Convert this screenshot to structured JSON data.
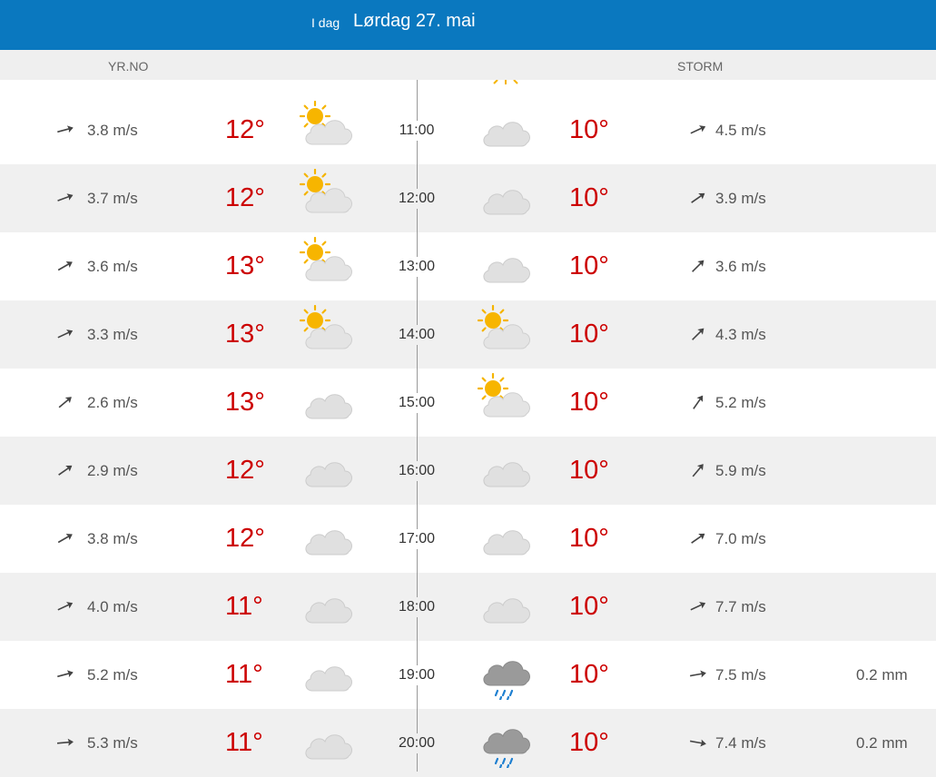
{
  "header": {
    "today_label": "I dag",
    "date": "Lørdag 27. mai",
    "color": "#0a78bf"
  },
  "sources": {
    "left": "YR.NO",
    "right": "STORM"
  },
  "colors": {
    "temperature": "#cc0000",
    "row_alt": "#f0f0f0"
  },
  "rows": [
    {
      "time": "11:00",
      "yr": {
        "wind_dir_deg": -15,
        "wind": "3.8 m/s",
        "temp": "12°",
        "icon": "partly-cloudy-icon"
      },
      "storm": {
        "icon": "cloudy-icon",
        "temp": "10°",
        "wind_dir_deg": -25,
        "wind": "4.5 m/s",
        "precip": ""
      }
    },
    {
      "time": "12:00",
      "yr": {
        "wind_dir_deg": -20,
        "wind": "3.7 m/s",
        "temp": "12°",
        "icon": "partly-cloudy-icon"
      },
      "storm": {
        "icon": "cloudy-icon",
        "temp": "10°",
        "wind_dir_deg": -35,
        "wind": "3.9 m/s",
        "precip": ""
      }
    },
    {
      "time": "13:00",
      "yr": {
        "wind_dir_deg": -30,
        "wind": "3.6 m/s",
        "temp": "13°",
        "icon": "partly-cloudy-icon"
      },
      "storm": {
        "icon": "cloudy-icon",
        "temp": "10°",
        "wind_dir_deg": -45,
        "wind": "3.6 m/s",
        "precip": ""
      }
    },
    {
      "time": "14:00",
      "yr": {
        "wind_dir_deg": -25,
        "wind": "3.3 m/s",
        "temp": "13°",
        "icon": "partly-cloudy-icon"
      },
      "storm": {
        "icon": "partly-cloudy-icon",
        "temp": "10°",
        "wind_dir_deg": -45,
        "wind": "4.3 m/s",
        "precip": ""
      }
    },
    {
      "time": "15:00",
      "yr": {
        "wind_dir_deg": -40,
        "wind": "2.6 m/s",
        "temp": "13°",
        "icon": "cloudy-icon"
      },
      "storm": {
        "icon": "partly-cloudy-icon",
        "temp": "10°",
        "wind_dir_deg": -55,
        "wind": "5.2 m/s",
        "precip": ""
      }
    },
    {
      "time": "16:00",
      "yr": {
        "wind_dir_deg": -35,
        "wind": "2.9 m/s",
        "temp": "12°",
        "icon": "cloudy-icon"
      },
      "storm": {
        "icon": "cloudy-icon",
        "temp": "10°",
        "wind_dir_deg": -50,
        "wind": "5.9 m/s",
        "precip": ""
      }
    },
    {
      "time": "17:00",
      "yr": {
        "wind_dir_deg": -30,
        "wind": "3.8 m/s",
        "temp": "12°",
        "icon": "cloudy-icon"
      },
      "storm": {
        "icon": "cloudy-icon",
        "temp": "10°",
        "wind_dir_deg": -35,
        "wind": "7.0 m/s",
        "precip": ""
      }
    },
    {
      "time": "18:00",
      "yr": {
        "wind_dir_deg": -25,
        "wind": "4.0 m/s",
        "temp": "11°",
        "icon": "cloudy-icon"
      },
      "storm": {
        "icon": "cloudy-icon",
        "temp": "10°",
        "wind_dir_deg": -25,
        "wind": "7.7 m/s",
        "precip": ""
      }
    },
    {
      "time": "19:00",
      "yr": {
        "wind_dir_deg": -15,
        "wind": "5.2 m/s",
        "temp": "11°",
        "icon": "cloudy-icon"
      },
      "storm": {
        "icon": "rain-icon",
        "temp": "10°",
        "wind_dir_deg": -10,
        "wind": "7.5 m/s",
        "precip": "0.2 mm"
      }
    },
    {
      "time": "20:00",
      "yr": {
        "wind_dir_deg": -5,
        "wind": "5.3 m/s",
        "temp": "11°",
        "icon": "cloudy-icon"
      },
      "storm": {
        "icon": "rain-icon",
        "temp": "10°",
        "wind_dir_deg": 10,
        "wind": "7.4 m/s",
        "precip": "0.2 mm"
      }
    }
  ]
}
